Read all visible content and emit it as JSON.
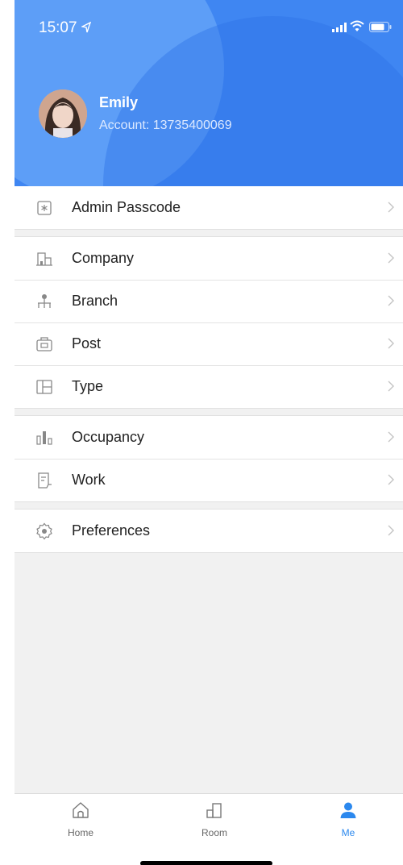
{
  "status_bar": {
    "time": "15:07"
  },
  "profile": {
    "name": "Emily",
    "account": "Account: 13735400069"
  },
  "menu_groups": [
    [
      {
        "label": "Admin Passcode",
        "icon": "passcode-icon"
      }
    ],
    [
      {
        "label": "Company",
        "icon": "company-icon"
      },
      {
        "label": "Branch",
        "icon": "branch-icon"
      },
      {
        "label": "Post",
        "icon": "post-icon"
      },
      {
        "label": "Type",
        "icon": "type-icon"
      }
    ],
    [
      {
        "label": "Occupancy",
        "icon": "occupancy-icon"
      },
      {
        "label": "Work",
        "icon": "work-icon"
      }
    ],
    [
      {
        "label": "Preferences",
        "icon": "preferences-icon"
      }
    ]
  ],
  "tabbar": {
    "home": "Home",
    "room": "Room",
    "me": "Me"
  },
  "colors": {
    "accent": "#2b88ee",
    "header": "#3f86f2"
  }
}
